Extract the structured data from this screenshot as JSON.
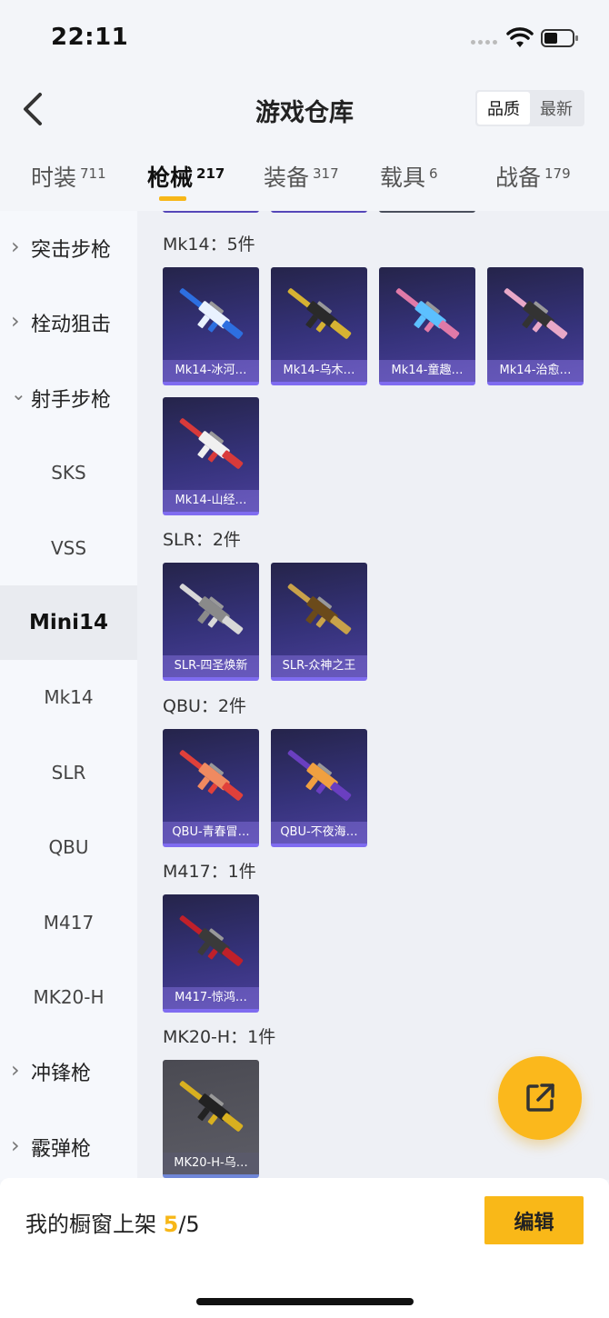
{
  "status_bar": {
    "time": "22:11"
  },
  "header": {
    "title": "游戏仓库",
    "sort_options": [
      "品质",
      "最新"
    ],
    "sort_selected": "品质"
  },
  "tabs": [
    {
      "label": "时装",
      "count": "711"
    },
    {
      "label": "枪械",
      "count": "217",
      "active": true
    },
    {
      "label": "装备",
      "count": "317"
    },
    {
      "label": "载具",
      "count": "6"
    },
    {
      "label": "战备",
      "count": "179"
    }
  ],
  "sidebar": [
    {
      "label": "突击步枪",
      "type": "category",
      "expanded": false
    },
    {
      "label": "栓动狙击",
      "type": "category",
      "expanded": false
    },
    {
      "label": "射手步枪",
      "type": "category",
      "expanded": true
    },
    {
      "label": "SKS",
      "type": "sub"
    },
    {
      "label": "VSS",
      "type": "sub"
    },
    {
      "label": "Mini14",
      "type": "sub",
      "active": true
    },
    {
      "label": "Mk14",
      "type": "sub"
    },
    {
      "label": "SLR",
      "type": "sub"
    },
    {
      "label": "QBU",
      "type": "sub"
    },
    {
      "label": "M417",
      "type": "sub"
    },
    {
      "label": "MK20-H",
      "type": "sub"
    },
    {
      "label": "冲锋枪",
      "type": "category",
      "expanded": false
    },
    {
      "label": "霰弹枪",
      "type": "category",
      "expanded": false
    }
  ],
  "groups": [
    {
      "title": "Mk14：5件",
      "items": [
        {
          "label": "Mk14-冰河…",
          "colors": [
            "#2d6fe0",
            "#e9f2ff"
          ]
        },
        {
          "label": "Mk14-乌木…",
          "colors": [
            "#d6b232",
            "#2a2a2a"
          ]
        },
        {
          "label": "Mk14-童趣…",
          "colors": [
            "#e07aa8",
            "#5cc0ff"
          ]
        },
        {
          "label": "Mk14-治愈…",
          "colors": [
            "#e8a8c8",
            "#333333"
          ]
        },
        {
          "label": "Mk14-山经…",
          "colors": [
            "#d83a3a",
            "#f0f0f0"
          ]
        }
      ]
    },
    {
      "title": "SLR：2件",
      "items": [
        {
          "label": "SLR-四圣焕新",
          "colors": [
            "#d8d8d8",
            "#8a8a8a"
          ]
        },
        {
          "label": "SLR-众神之王",
          "colors": [
            "#c8a24a",
            "#6b4a1a"
          ]
        }
      ]
    },
    {
      "title": "QBU：2件",
      "items": [
        {
          "label": "QBU-青春冒…",
          "colors": [
            "#e0403a",
            "#f08a60"
          ]
        },
        {
          "label": "QBU-不夜海…",
          "colors": [
            "#6a3fc0",
            "#f0a040"
          ]
        }
      ]
    },
    {
      "title": "M417：1件",
      "items": [
        {
          "label": "M417-惊鸿…",
          "colors": [
            "#c0202a",
            "#3a3a3a"
          ]
        }
      ]
    },
    {
      "title": "MK20-H：1件",
      "items": [
        {
          "label": "MK20-H-乌…",
          "colors": [
            "#d8b020",
            "#222222"
          ],
          "gold": true
        }
      ]
    }
  ],
  "bottom_bar": {
    "shelf_label": "我的橱窗上架",
    "shelf_count": "5",
    "shelf_total": "/5",
    "edit_label": "编辑"
  },
  "accent_color": "#f7b718"
}
